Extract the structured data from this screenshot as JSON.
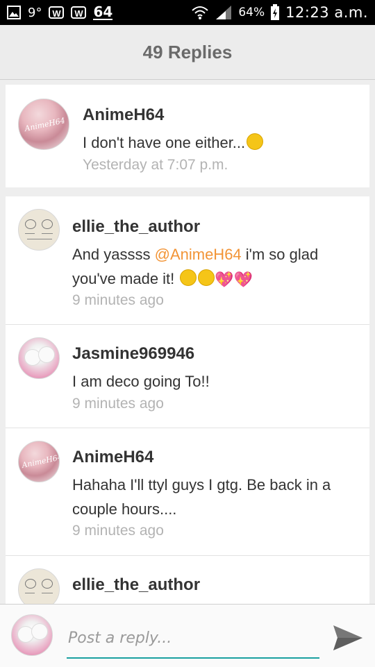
{
  "status_bar": {
    "temp": "9°",
    "w1": "W",
    "w2": "W",
    "count": "64",
    "battery": "64%",
    "time": "12:23 a.m."
  },
  "header": {
    "title": "49 Replies"
  },
  "original_post": {
    "username": "AnimeH64",
    "avatar_text": "AnimeH64",
    "message": "I don't have one either...",
    "time": "Yesterday at 7:07 p.m."
  },
  "replies": [
    {
      "username": "ellie_the_author",
      "message_pre": "And yassss ",
      "mention": "@AnimeH64",
      "message_post": " i'm so glad you've made it!",
      "time": "9 minutes ago"
    },
    {
      "username": "Jasmine969946",
      "message": "I am deco going To!!",
      "time": "9 minutes ago"
    },
    {
      "username": "AnimeH64",
      "avatar_text": "AnimeH64",
      "message": "Hahaha I'll ttyl guys I gtg. Be back in a couple hours....",
      "time": "9 minutes ago"
    },
    {
      "username": "ellie_the_author"
    }
  ],
  "reply_box": {
    "placeholder": "Post a reply..."
  },
  "colors": {
    "mention": "#f29436",
    "accent": "#1aa0a0",
    "heart": "#e0338b"
  }
}
